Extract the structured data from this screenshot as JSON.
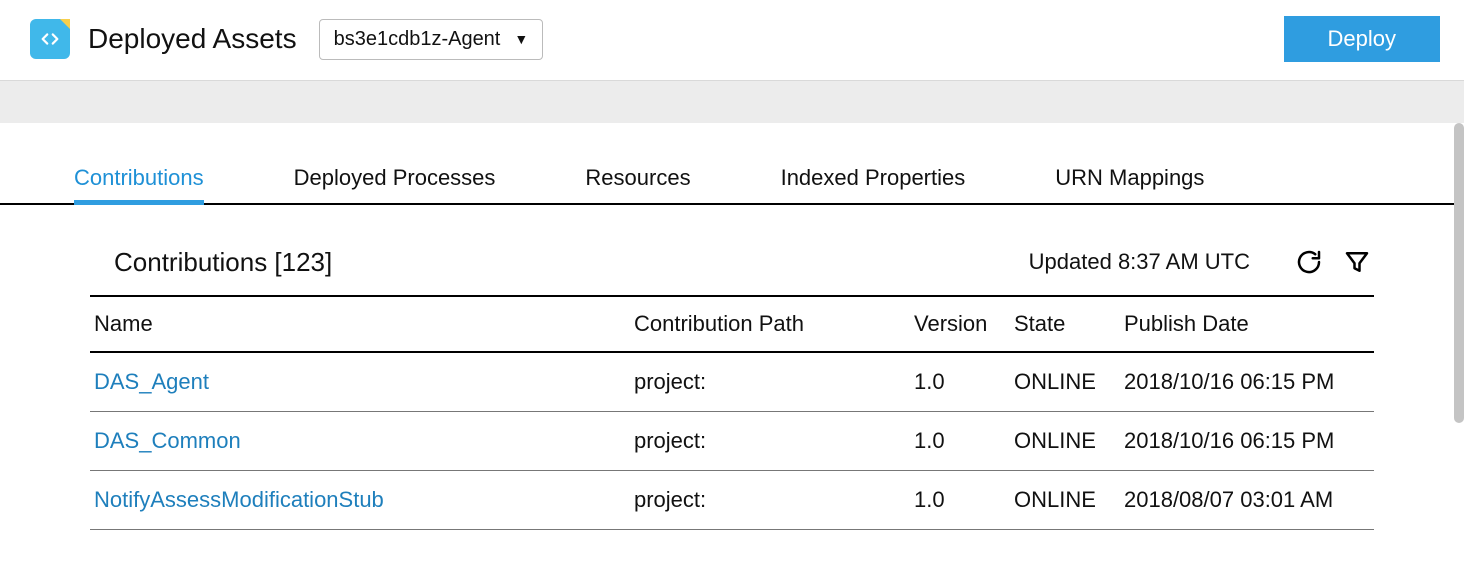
{
  "header": {
    "title": "Deployed Assets",
    "agent_selected": "bs3e1cdb1z-Agent",
    "deploy_label": "Deploy"
  },
  "tabs": [
    {
      "label": "Contributions",
      "active": true
    },
    {
      "label": "Deployed Processes",
      "active": false
    },
    {
      "label": "Resources",
      "active": false
    },
    {
      "label": "Indexed Properties",
      "active": false
    },
    {
      "label": "URN Mappings",
      "active": false
    }
  ],
  "section": {
    "title": "Contributions [123]",
    "updated": "Updated 8:37 AM UTC"
  },
  "table": {
    "columns": {
      "name": "Name",
      "path": "Contribution Path",
      "version": "Version",
      "state": "State",
      "publish": "Publish Date"
    },
    "rows": [
      {
        "name": "DAS_Agent",
        "path": "project:",
        "version": "1.0",
        "state": "ONLINE",
        "publish": "2018/10/16 06:15 PM"
      },
      {
        "name": "DAS_Common",
        "path": "project:",
        "version": "1.0",
        "state": "ONLINE",
        "publish": "2018/10/16 06:15 PM"
      },
      {
        "name": "NotifyAssessModificationStub",
        "path": "project:",
        "version": "1.0",
        "state": "ONLINE",
        "publish": "2018/08/07 03:01 AM"
      }
    ]
  }
}
